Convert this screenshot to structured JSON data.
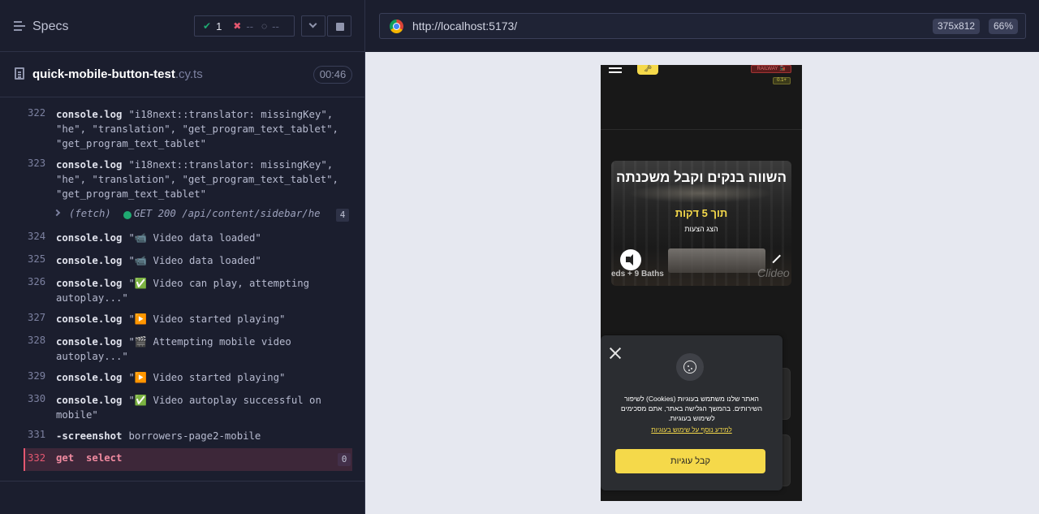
{
  "reporter": {
    "specs_label": "Specs",
    "stats": {
      "passed": "1",
      "failed": "--",
      "pending": "--"
    },
    "file": {
      "name": "quick-mobile-button-test",
      "ext": ".cy.ts",
      "duration": "00:46"
    }
  },
  "log": [
    {
      "num": "322",
      "cmd": "console.log",
      "arg": "\"i18next::translator: missingKey\", \"he\", \"translation\", \"get_program_text_tablet\", \"get_program_text_tablet\""
    },
    {
      "num": "323",
      "cmd": "console.log",
      "arg": "\"i18next::translator: missingKey\", \"he\", \"translation\", \"get_program_text_tablet\", \"get_program_text_tablet\""
    },
    {
      "num": "324",
      "cmd": "console.log",
      "arg": "\"📹 Video data loaded\""
    },
    {
      "num": "325",
      "cmd": "console.log",
      "arg": "\"📹 Video data loaded\""
    },
    {
      "num": "326",
      "cmd": "console.log",
      "arg": "\"✅ Video can play, attempting autoplay...\""
    },
    {
      "num": "327",
      "cmd": "console.log",
      "arg": "\"▶️ Video started playing\""
    },
    {
      "num": "328",
      "cmd": "console.log",
      "arg": "\"🎬 Attempting mobile video autoplay...\""
    },
    {
      "num": "329",
      "cmd": "console.log",
      "arg": "\"▶️ Video started playing\""
    },
    {
      "num": "330",
      "cmd": "console.log",
      "arg": "\"✅ Video autoplay successful on mobile\""
    },
    {
      "num": "331",
      "cmd": "-screenshot",
      "arg": "borrowers-page2-mobile"
    }
  ],
  "fetch": {
    "label": "(fetch)",
    "text": "GET 200 /api/content/sidebar/he",
    "count": "4"
  },
  "active": {
    "num": "332",
    "cmd": "get",
    "arg": "select",
    "count": "0"
  },
  "browser": {
    "url": "http://localhost:5173/",
    "viewport": "375x812",
    "zoom": "66%"
  },
  "aut": {
    "tag_railway": "RAILWAY 🚂",
    "tag_version": "0.1+",
    "logo": "🗝",
    "hero": {
      "title": "השווה בנקים וקבל משכנתה",
      "subtitle": "תוך 5 דקות",
      "small": "הצג הצעות",
      "caption": "eds + 9 Baths",
      "watermark": "Clideo"
    },
    "cookie": {
      "text": "האתר שלנו משתמש בעוגיות (Cookies) לשיפור השירותים. בהמשך הגלישה באתר, אתם מסכימים לשימוש בעוגיות.",
      "link": "למידע נוסף על שימוש בעוגיות",
      "accept": "קבל עוגיות"
    }
  },
  "colors": {
    "accent": "#f5d94a",
    "pass": "#1fa971",
    "fail": "#e45770"
  }
}
